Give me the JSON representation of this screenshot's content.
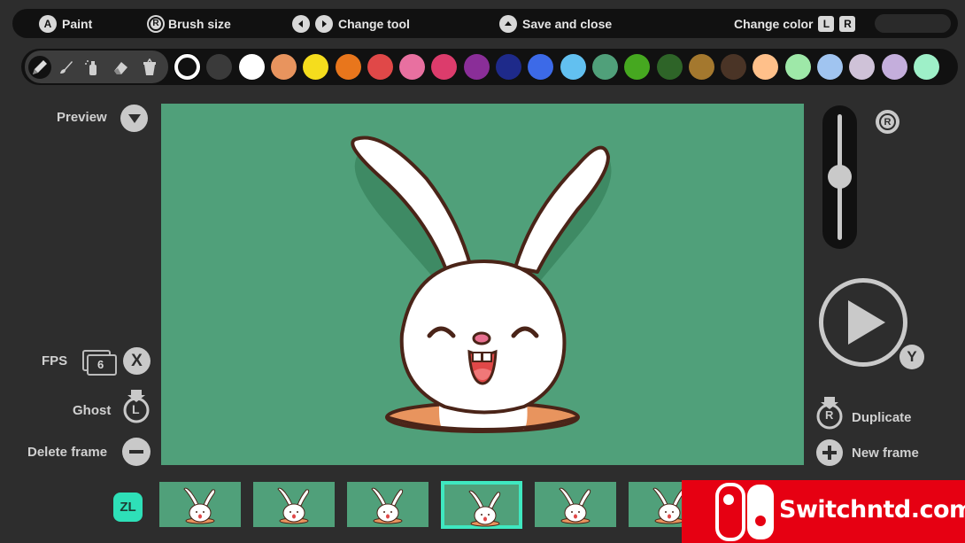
{
  "hints": {
    "paint_button": "A",
    "paint_label": "Paint",
    "brush_button": "R",
    "brush_label": "Brush size",
    "change_tool_label": "Change tool",
    "save_label": "Save and close",
    "change_color_label": "Change color",
    "color_left": "L",
    "color_right": "R"
  },
  "tools": [
    "pencil-icon",
    "brush-icon",
    "spray-icon",
    "eraser-icon",
    "bucket-icon"
  ],
  "palette": [
    "#111111",
    "#3a3a3a",
    "#ffffff",
    "#e8945e",
    "#f5dd1d",
    "#e8761c",
    "#e04848",
    "#e870a0",
    "#dc3c6c",
    "#8a2e98",
    "#1e2a8a",
    "#3c6ae8",
    "#62c0f0",
    "#50a07a",
    "#46a820",
    "#2e6428",
    "#a4782e",
    "#4a3426",
    "#ffc08a",
    "#9ee8a8",
    "#a0c4f0",
    "#cfc2d8",
    "#c4aedc",
    "#9ef0c8"
  ],
  "left": {
    "preview_label": "Preview",
    "fps_label": "FPS",
    "fps_value": "6",
    "fps_button": "X",
    "ghost_label": "Ghost",
    "ghost_button": "L",
    "delete_label": "Delete frame"
  },
  "right": {
    "slider_button": "R",
    "play_button": "Y",
    "duplicate_button": "R",
    "duplicate_label": "Duplicate",
    "new_frame_label": "New frame"
  },
  "timeline": {
    "zl_label": "ZL",
    "frames": 6,
    "selected_frame": 4
  },
  "watermark": "Switchntd.com",
  "colors": {
    "canvas_bg": "#50a07a",
    "accent": "#3fe8c0",
    "brand_red": "#e60012"
  }
}
